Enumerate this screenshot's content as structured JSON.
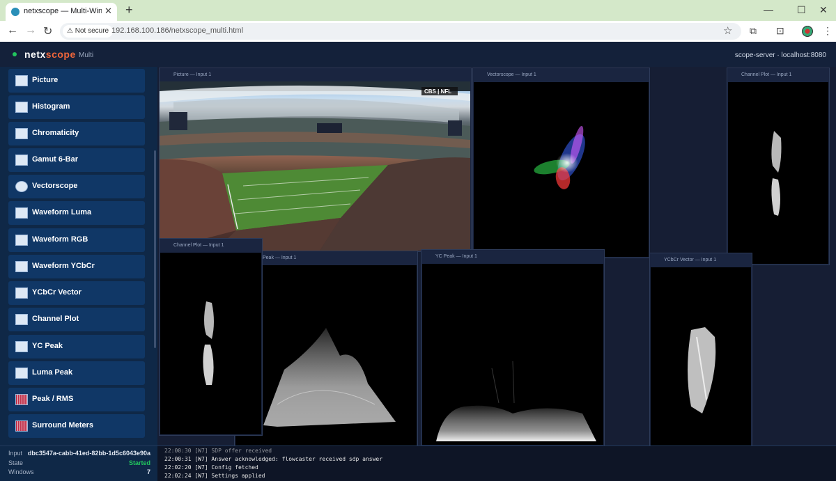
{
  "browser": {
    "tab_title": "netxscope — Multi-Window M",
    "not_secure": "Not secure",
    "url": "192.168.100.186/netxscope_multi.html"
  },
  "app": {
    "brand_part1": "netx",
    "brand_part2": "scope",
    "mode": "Multi",
    "server": "scope-server · localhost:8080"
  },
  "sidebar": {
    "items": [
      {
        "label": "Picture",
        "icon": "picture-icon"
      },
      {
        "label": "Histogram",
        "icon": "histogram-icon"
      },
      {
        "label": "Chromaticity",
        "icon": "chromaticity-icon"
      },
      {
        "label": "Gamut 6-Bar",
        "icon": "gamut-icon"
      },
      {
        "label": "Vectorscope",
        "icon": "vectorscope-icon"
      },
      {
        "label": "Waveform Luma",
        "icon": "waveform-luma-icon"
      },
      {
        "label": "Waveform RGB",
        "icon": "waveform-rgb-icon"
      },
      {
        "label": "Waveform YCbCr",
        "icon": "waveform-ycbcr-icon"
      },
      {
        "label": "YCbCr Vector",
        "icon": "ycbcr-vector-icon"
      },
      {
        "label": "Channel Plot",
        "icon": "channel-plot-icon"
      },
      {
        "label": "YC Peak",
        "icon": "yc-peak-icon"
      },
      {
        "label": "Luma Peak",
        "icon": "luma-peak-icon"
      },
      {
        "label": "Peak / RMS",
        "icon": "peak-rms-icon"
      },
      {
        "label": "Surround Meters",
        "icon": "surround-meters-icon"
      }
    ],
    "footer": {
      "input_label": "Input",
      "input_value": "dbc3547a-cabb-41ed-82bb-1d5c6043e90a",
      "state_label": "State",
      "state_value": "Started",
      "windows_label": "Windows",
      "windows_value": "7"
    }
  },
  "panels": {
    "picture": "Picture — Input 1",
    "vectorscope": "Vectorscope — Input 1",
    "channel_plot_right": "Channel Plot — Input 1",
    "channel_plot_left": "Channel Plot — Input 1",
    "luma_peak": "Peak — Input 1",
    "yc_peak": "YC Peak — Input 1",
    "ycbcr_vector": "YCbCr Vector — Input 1"
  },
  "broadcast_logo": "CBS | NFL",
  "log": [
    "22:00:30 [W7] SDP offer received",
    "22:00:31 [W7] Answer acknowledged: flowcaster received sdp answer",
    "22:02:20 [W7] Config fetched",
    "22:02:24 [W7] Settings applied"
  ],
  "colors": {
    "accent": "#f0663a",
    "status_ok": "#22c55e",
    "sidebar_button": "#103766"
  }
}
